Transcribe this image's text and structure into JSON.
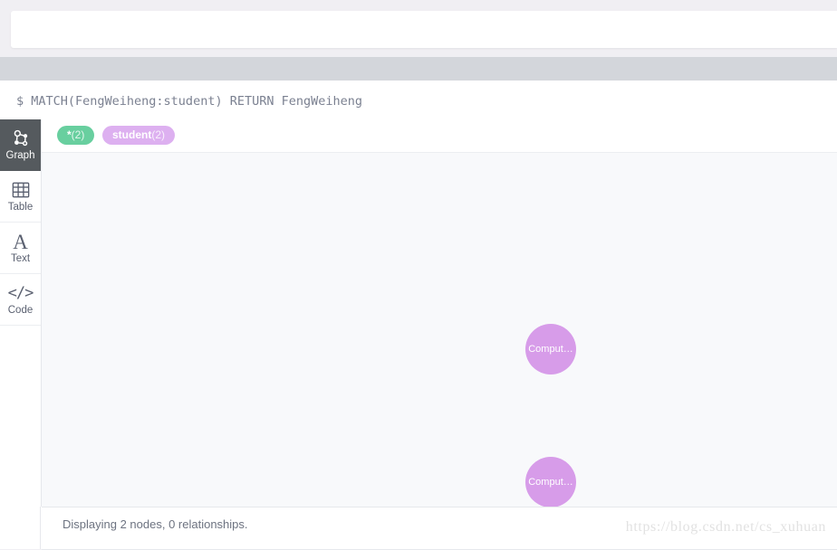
{
  "editor": {
    "prompt": "$",
    "tokens": [
      {
        "text": "MATCH",
        "kind": "keyword"
      },
      {
        "text": "(",
        "kind": "paren"
      },
      {
        "text": "FengWeiheng",
        "kind": "ident"
      },
      {
        "text": ":student",
        "kind": "colon"
      },
      {
        "text": ")",
        "kind": "paren"
      },
      {
        "text": "  ",
        "kind": "plain"
      },
      {
        "text": "RETURN",
        "kind": "keyword"
      },
      {
        "text": " FengWeiheng",
        "kind": "plain"
      }
    ],
    "full_query": "MATCH(FengWeiheng:student)  RETURN FengWeiheng"
  },
  "results": {
    "query_echo": "$ MATCH(FengWeiheng:student) RETURN FengWeiheng",
    "status_text": "Displaying 2 nodes, 0 relationships."
  },
  "view_tabs": [
    {
      "id": "graph",
      "label": "Graph",
      "icon": "graph-icon",
      "active": true
    },
    {
      "id": "table",
      "label": "Table",
      "icon": "table-icon",
      "active": false
    },
    {
      "id": "text",
      "label": "Text",
      "icon": "text-icon",
      "active": false
    },
    {
      "id": "code",
      "label": "Code",
      "icon": "code-icon",
      "active": false
    }
  ],
  "legend": [
    {
      "id": "all",
      "label": "*",
      "count": "(2)",
      "color": "#68cf9f"
    },
    {
      "id": "student",
      "label": "student",
      "count": "(2)",
      "color": "#ddb0f0"
    }
  ],
  "graph": {
    "node_color": "#d79ce9",
    "canvas_bg": "#f8f9fb",
    "nodes": [
      {
        "id": "n1",
        "caption": "Comput…",
        "label": "student"
      },
      {
        "id": "n2",
        "caption": "Comput…",
        "label": "student"
      }
    ]
  },
  "watermark": {
    "text": "https://blog.csdn.net/cs_xuhuan"
  }
}
